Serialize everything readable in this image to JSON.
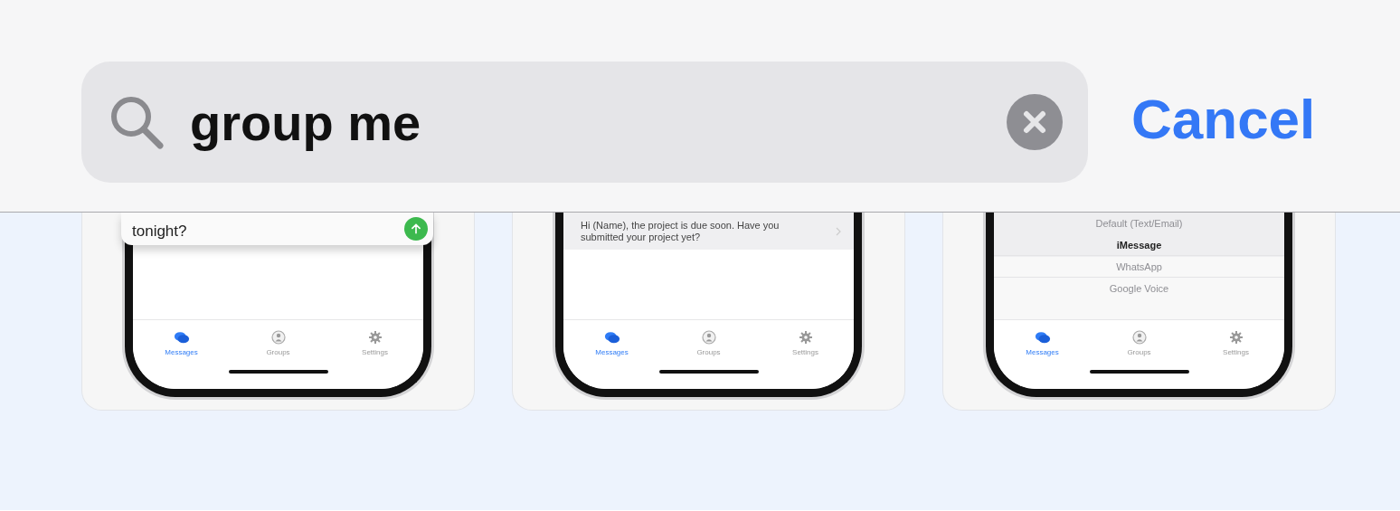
{
  "search": {
    "value": "group me"
  },
  "cancel": "Cancel",
  "screenshots": [
    {
      "kind": "compose",
      "message": "tonight?",
      "tabs": [
        {
          "kind": "chat",
          "label": "Messages",
          "selected": true
        },
        {
          "kind": "person",
          "label": "Groups",
          "selected": false
        },
        {
          "kind": "gear",
          "label": "Settings",
          "selected": false
        }
      ]
    },
    {
      "kind": "row",
      "message": "Hi (Name), the project is due soon. Have you submitted your project yet?",
      "tabs": [
        {
          "kind": "chat",
          "label": "Messages",
          "selected": true
        },
        {
          "kind": "person",
          "label": "Groups",
          "selected": false
        },
        {
          "kind": "gear",
          "label": "Settings",
          "selected": false
        }
      ]
    },
    {
      "kind": "picker",
      "options": [
        {
          "label": "Default (Text/Email)",
          "selected": false
        },
        {
          "label": "iMessage",
          "selected": true
        },
        {
          "label": "WhatsApp",
          "selected": false
        },
        {
          "label": "Google Voice",
          "selected": false
        }
      ],
      "tabs": [
        {
          "kind": "chat",
          "label": "Messages",
          "selected": true
        },
        {
          "kind": "person",
          "label": "Groups",
          "selected": false
        },
        {
          "kind": "gear",
          "label": "Settings",
          "selected": false
        }
      ]
    }
  ]
}
